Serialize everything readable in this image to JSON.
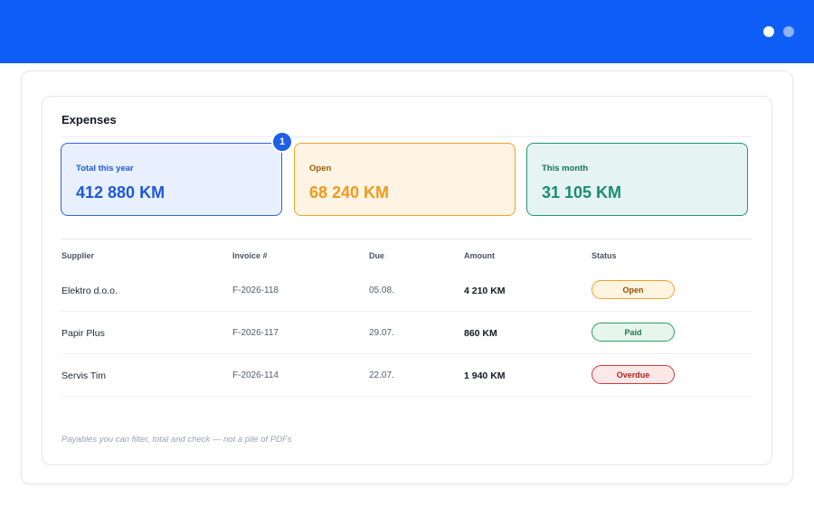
{
  "window": {
    "dots": [
      "white-dot",
      "light-blue-dot"
    ]
  },
  "panel": {
    "title": "Expenses",
    "badge": "1"
  },
  "stats": [
    {
      "label": "Total this year",
      "value": "412 880 KM",
      "color": "#2157d8"
    },
    {
      "label": "Open",
      "value": "68 240 KM",
      "color": "#f09a1a"
    },
    {
      "label": "This month",
      "value": "31 105 KM",
      "color": "#1a8d70"
    }
  ],
  "table": {
    "headers": [
      "Supplier",
      "Invoice #",
      "Due",
      "Amount",
      "Status"
    ],
    "rows": [
      {
        "supplier": "Elektro d.o.o.",
        "invoice": "F-2026-118",
        "due": "05.08.",
        "amount": "4 210 KM",
        "status": "Open"
      },
      {
        "supplier": "Papir Plus",
        "invoice": "F-2026-117",
        "due": "29.07.",
        "amount": "860 KM",
        "status": "Paid"
      },
      {
        "supplier": "Servis Tim",
        "invoice": "F-2026-114",
        "due": "22.07.",
        "amount": "1 940 KM",
        "status": "Overdue"
      }
    ]
  },
  "footnote": "Payables you can filter, total and check — not a pile of PDFs",
  "colors": {
    "accent": "#0f5ef7",
    "open": "#f0a12a",
    "paid": "#2f9c5a",
    "overdue": "#d23b3b"
  }
}
